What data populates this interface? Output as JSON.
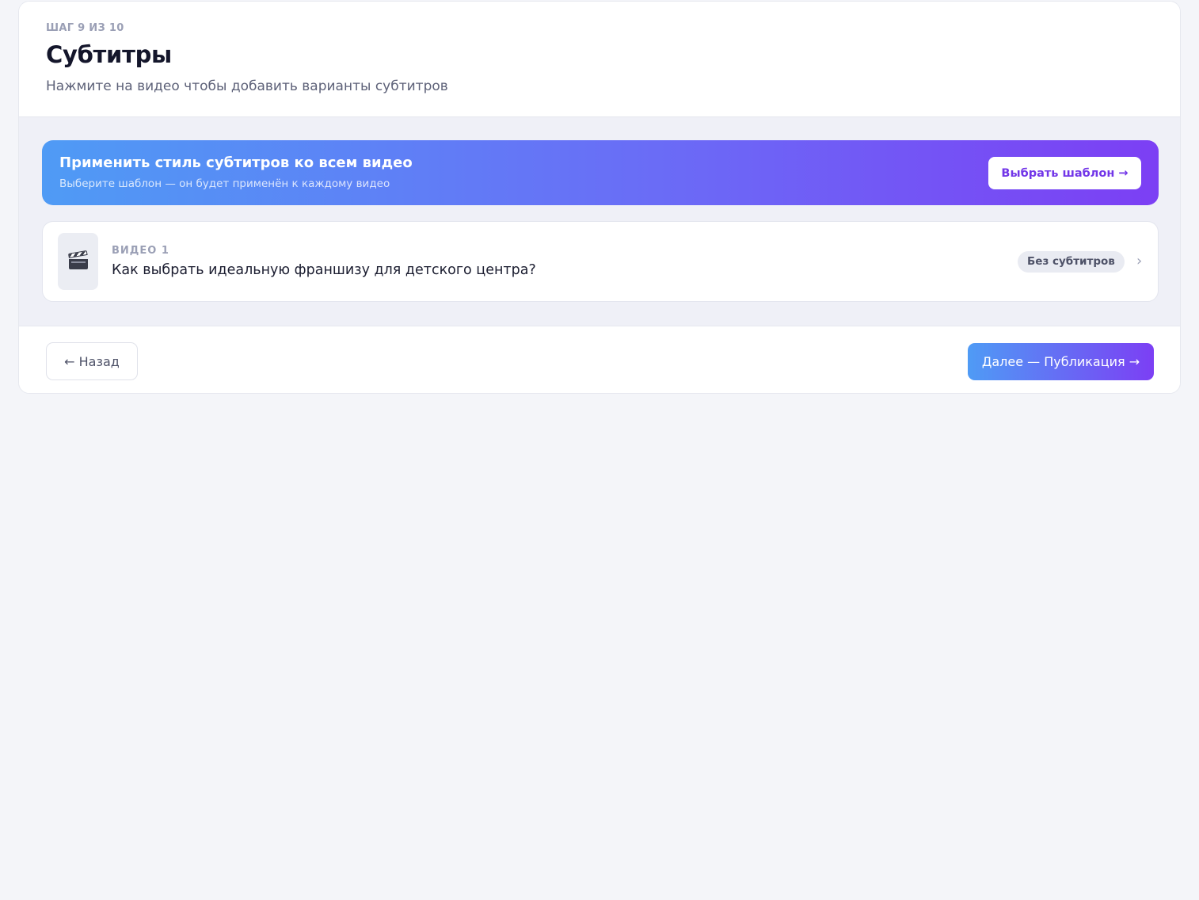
{
  "header": {
    "step": "ШАГ 9 ИЗ 10",
    "title": "Субтитры",
    "subtitle": "Нажмите на видео чтобы добавить варианты субтитров"
  },
  "banner": {
    "title": "Применить стиль субтитров ко всем видео",
    "subtitle": "Выберите шаблон — он будет применён к каждому видео",
    "button_label": "Выбрать шаблон →"
  },
  "videos": [
    {
      "label": "ВИДЕО 1",
      "title": "Как выбрать идеальную франшизу для детского центра?",
      "status": "Без субтитров",
      "icon": "clapperboard-icon",
      "chevron": "›"
    }
  ],
  "footer": {
    "back_label": "← Назад",
    "next_label": "Далее — Публикация →"
  },
  "colors": {
    "accent_start": "#4f9bf5",
    "accent_end": "#7c3ff4",
    "button_text_accent": "#7236e8",
    "page_background": "#f4f5f9"
  }
}
